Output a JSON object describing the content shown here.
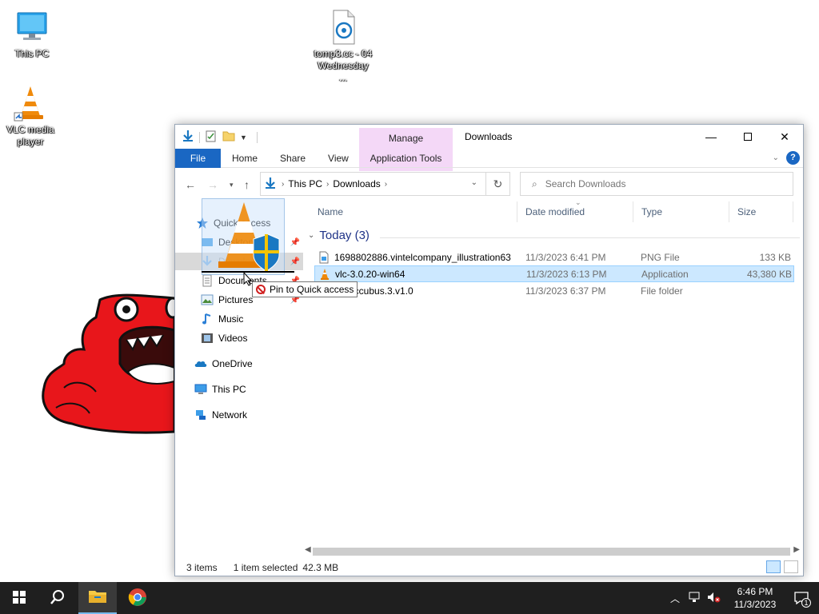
{
  "desktop": {
    "icons": [
      {
        "label": "This PC"
      },
      {
        "label": "VLC media player"
      },
      {
        "label": "tomp3.cc - 04 Wednesday ..."
      }
    ]
  },
  "window": {
    "title": "Downloads",
    "manage_tab": "Manage",
    "ribbon": {
      "file": "File",
      "home": "Home",
      "share": "Share",
      "view": "View",
      "app_tools": "Application Tools",
      "help": "?"
    },
    "address": {
      "crumbs": [
        "This PC",
        "Downloads"
      ]
    },
    "search": {
      "placeholder": "Search Downloads"
    },
    "nav": {
      "quick_access": "Quick access",
      "desktop": "Desktop",
      "downloads": "Downloads",
      "documents": "Documents",
      "pictures": "Pictures",
      "music": "Music",
      "videos": "Videos",
      "onedrive": "OneDrive",
      "this_pc": "This PC",
      "network": "Network"
    },
    "columns": [
      "Name",
      "Date modified",
      "Type",
      "Size"
    ],
    "group": "Today (3)",
    "files": [
      {
        "name": "1698802886.vintelcompany_illustration63",
        "date": "11/3/2023 6:41 PM",
        "type": "PNG File",
        "size": "133 KB"
      },
      {
        "name": "vlc-3.0.20-win64",
        "date": "11/3/2023 6:13 PM",
        "type": "Application",
        "size": "43,380 KB"
      },
      {
        "name": "ra.Succubus.3.v1.0",
        "date": "11/3/2023 6:37 PM",
        "type": "File folder",
        "size": ""
      }
    ],
    "status": {
      "items": "3 items",
      "selected": "1 item selected",
      "size": "42.3 MB"
    }
  },
  "drag": {
    "tooltip": "Pin to Quick access"
  },
  "taskbar": {
    "time": "6:46 PM",
    "date": "11/3/2023",
    "notif_count": "1"
  },
  "colors": {
    "accent": "#1a67c3",
    "selection": "#cce8ff",
    "manage_tab": "#f4d8f7",
    "taskbar": "#1f1f1f",
    "monster": "#e8161b"
  }
}
